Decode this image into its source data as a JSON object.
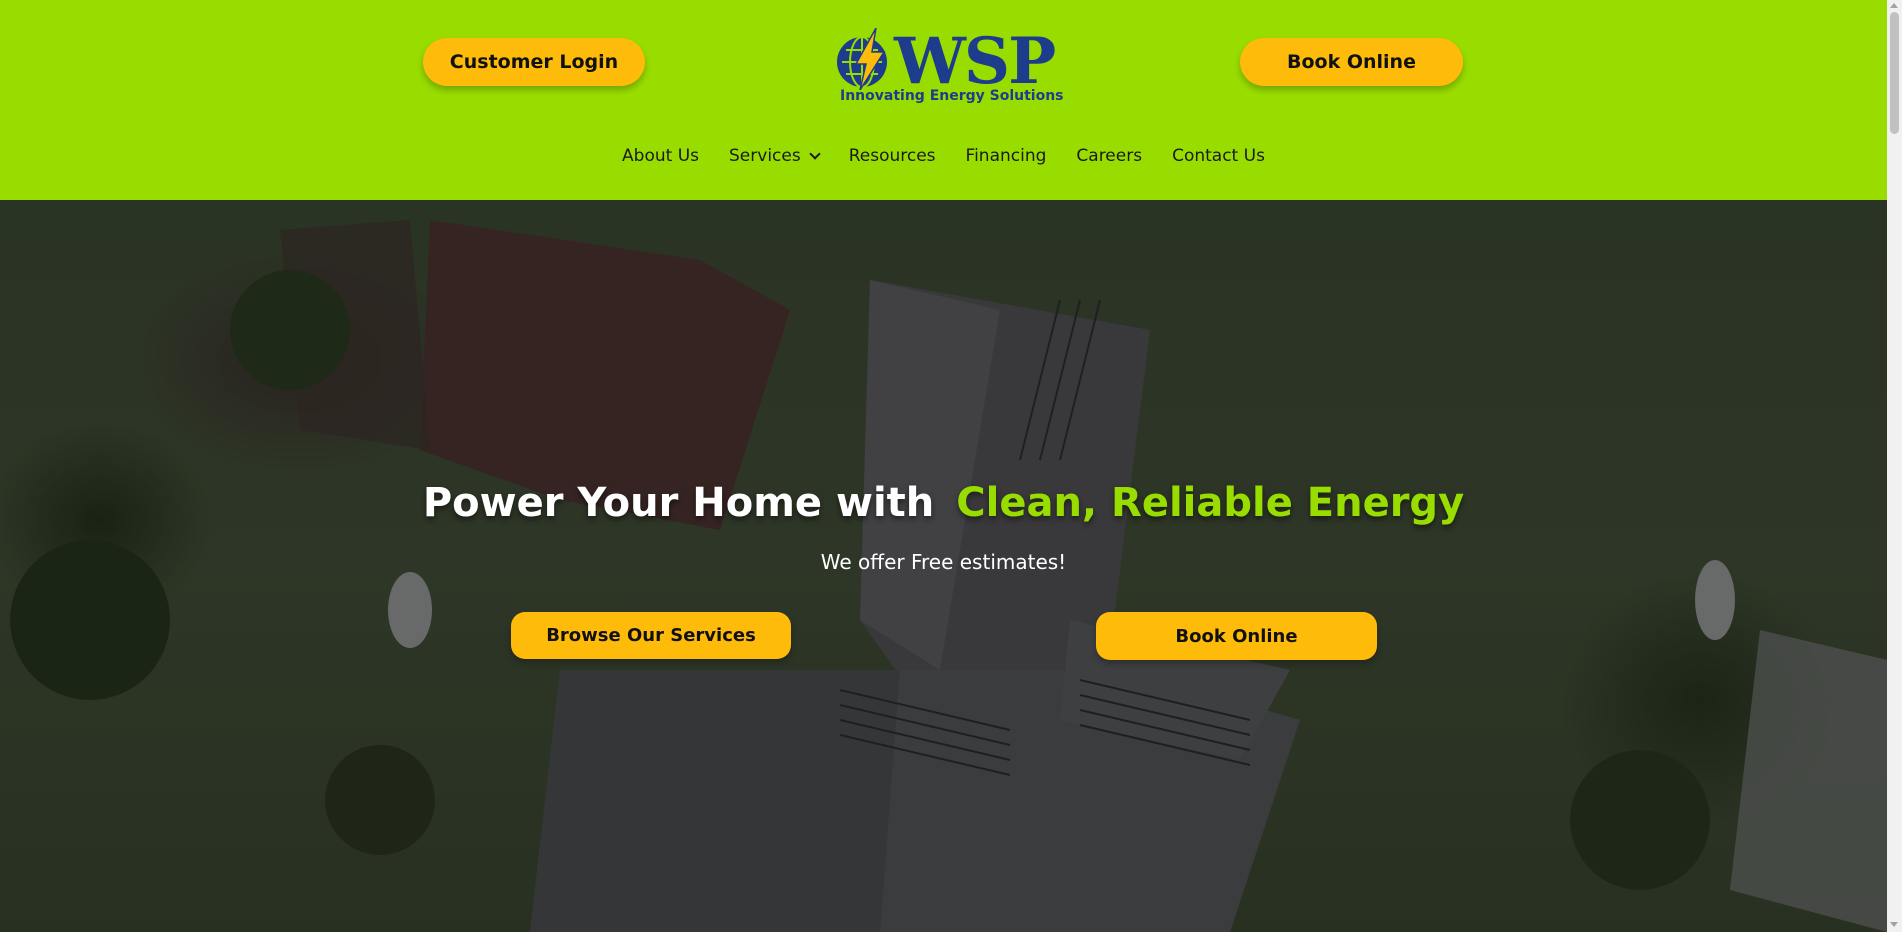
{
  "header": {
    "customer_login_label": "Customer Login",
    "book_online_label": "Book Online",
    "logo": {
      "name": "WSP",
      "tagline": "Innovating Energy Solutions"
    }
  },
  "nav": {
    "items": [
      {
        "label": "About Us"
      },
      {
        "label": "Services",
        "icon": "chevron-down-icon"
      },
      {
        "label": "Resources"
      },
      {
        "label": "Financing"
      },
      {
        "label": "Careers"
      },
      {
        "label": "Contact Us"
      }
    ]
  },
  "hero": {
    "headline_white": "Power Your Home with",
    "headline_green": "Clean, Reliable Energy",
    "subheadline": "We offer Free estimates!",
    "browse_label": "Browse Our Services",
    "book_label": "Book Online"
  },
  "colors": {
    "header_bg": "#99dd00",
    "button_bg": "#ffbb0a",
    "logo_blue": "#1d3d8c",
    "accent_green": "#99dd00"
  }
}
